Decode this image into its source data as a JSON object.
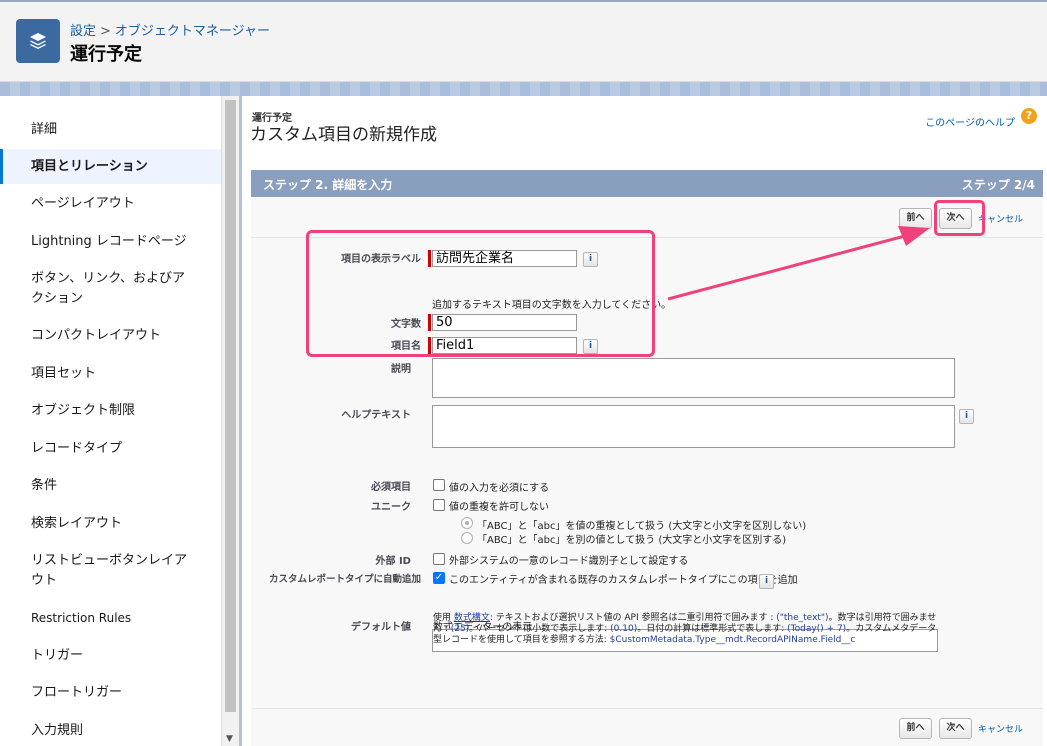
{
  "header": {
    "breadcrumb": [
      "設定",
      "オブジェクトマネージャー"
    ],
    "title": "運行予定"
  },
  "sidebar": {
    "items": [
      {
        "label": "詳細"
      },
      {
        "label": "項目とリレーション"
      },
      {
        "label": "ページレイアウト"
      },
      {
        "label": "Lightning レコードページ"
      },
      {
        "label": "ボタン、リンク、およびア"
      },
      {
        "label": "クション"
      },
      {
        "label": "コンパクトレイアウト"
      },
      {
        "label": "項目セット"
      },
      {
        "label": "オブジェクト制限"
      },
      {
        "label": "レコードタイプ"
      },
      {
        "label": "条件"
      },
      {
        "label": "検索レイアウト"
      },
      {
        "label": "リストビューボタンレイア"
      },
      {
        "label": "ウト"
      },
      {
        "label": "Restriction Rules"
      },
      {
        "label": "トリガー"
      },
      {
        "label": "フロートリガー"
      },
      {
        "label": "入力規則"
      }
    ]
  },
  "main": {
    "small_title": "運行予定",
    "big_title": "カスタム項目の新規作成",
    "help_link": "このページのヘルプ",
    "help_icon": "?",
    "step_left": "ステップ 2. 詳細を入力",
    "step_right": "ステップ 2/4",
    "prev_label": "前へ",
    "next_label": "次へ",
    "cancel_label": "キャンセル",
    "info_glyph": "i",
    "fields": {
      "display_label": {
        "label": "項目の表示ラベル",
        "value": "訪問先企業名"
      },
      "length_hint": "追加するテキスト項目の文字数を入力してください。",
      "length": {
        "label": "文字数",
        "value": "50"
      },
      "api_name": {
        "label": "項目名",
        "value": "Field1"
      },
      "description": {
        "label": "説明"
      },
      "help_text": {
        "label": "ヘルプテキスト"
      },
      "required": {
        "label": "必須項目",
        "option": "値の入力を必須にする"
      },
      "unique": {
        "label": "ユニーク",
        "option": "値の重複を許可しない",
        "radio1": "「ABC」と「abc」を値の重複として扱う (大文字と小文字を区別しない)",
        "radio2": "「ABC」と「abc」を別の値として扱う (大文字と小文字を区別する)"
      },
      "external_id": {
        "label": "外部 ID",
        "option": "外部システムの一意のレコード識別子として設定する"
      },
      "custom_report": {
        "label": "カスタムレポートタイプに自動追加",
        "option": "このエンティティが含まれる既存のカスタムレポートタイプにこの項目を追加"
      },
      "default_value": {
        "label": "デフォルト値",
        "formula_link": "数式エディターの表示"
      }
    },
    "note": {
      "p1": "使用 ",
      "syntax": "数式構文",
      "p2": ": テキストおよび選択リスト値の API 参照名は二重引用符で囲みます : ",
      "ex1": "(\"the_text\")",
      "p3": "。数字は引用符で囲みません : ",
      "ex2": "(25)",
      "p4": "。パーセントは小数で表示します: ",
      "ex3": "(0.10)",
      "p5": "。日付の計算は標準形式で表します: ",
      "ex4": "(Today() + 7)",
      "p6": "。カスタムメタデータ型レコードを使用して項目を参照する方法: ",
      "ex5": "$CustomMetadata.Type__mdt.RecordAPIName.Field__c"
    }
  },
  "colors": {
    "accent": "#f0417c",
    "step_bar": "#8a9ebe",
    "link": "#015ba7"
  }
}
